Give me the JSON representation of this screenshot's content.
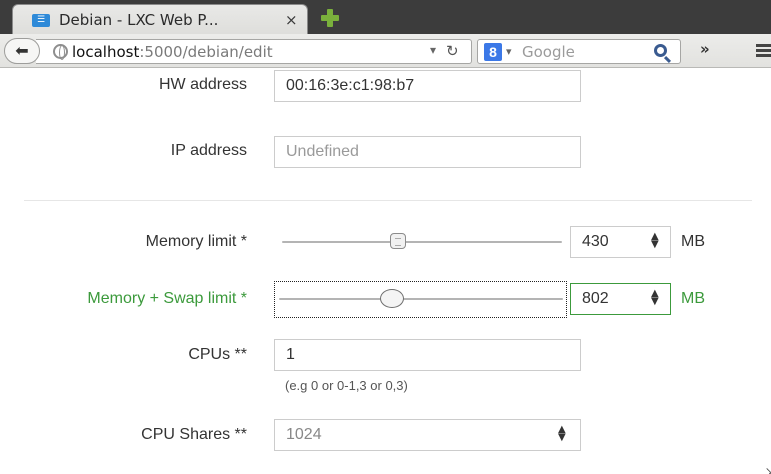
{
  "browser": {
    "tab_title": "Debian - LXC Web P...",
    "tab_favicon": "☰",
    "tab_close": "×",
    "url_host": "localhost",
    "url_rest": ":5000/debian/edit",
    "search_engine_logo": "8",
    "search_placeholder": "Google",
    "overflow": "»"
  },
  "form": {
    "hw_address": {
      "label": "HW address",
      "value": "00:16:3e:c1:98:b7"
    },
    "ip_address": {
      "label": "IP address",
      "placeholder": "Undefined"
    },
    "memory_limit": {
      "label": "Memory limit *",
      "value": "430",
      "unit": "MB",
      "slider_fraction": 0.42
    },
    "memory_swap_limit": {
      "label": "Memory + Swap limit *",
      "value": "802",
      "unit": "MB",
      "slider_fraction": 0.43
    },
    "cpus": {
      "label": "CPUs **",
      "value": "1",
      "help": "(e.g 0 or 0-1,3 or 0,3)"
    },
    "cpu_shares": {
      "label": "CPU Shares **",
      "value": "1024"
    }
  },
  "colors": {
    "valid_green": "#3c9a3c",
    "tab_bar": "#3c3c3c"
  }
}
